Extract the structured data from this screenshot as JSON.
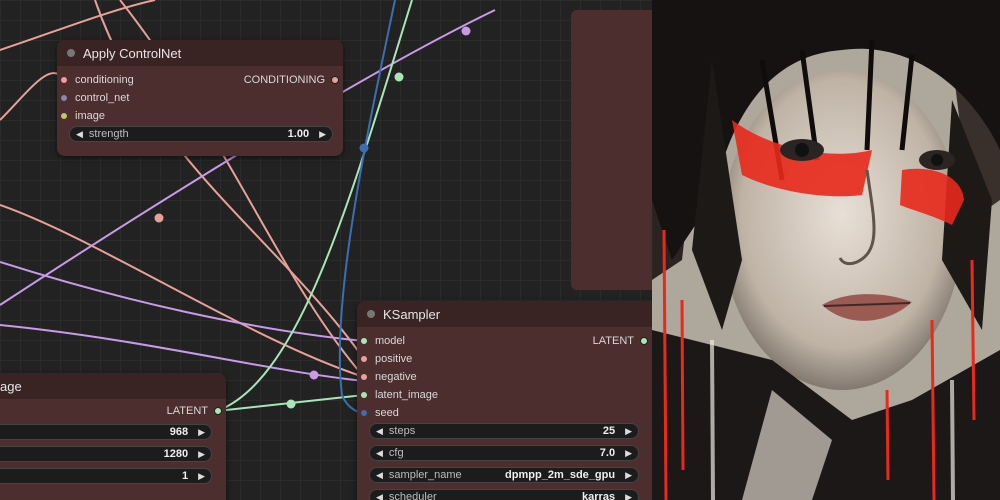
{
  "nodes": {
    "apply_controlnet": {
      "title": "Apply ControlNet",
      "inputs": [
        "conditioning",
        "control_net",
        "image"
      ],
      "output": "CONDITIONING",
      "widgets": [
        {
          "label": "strength",
          "value": "1.00"
        }
      ]
    },
    "ksampler": {
      "title": "KSampler",
      "inputs": [
        "model",
        "positive",
        "negative",
        "latent_image",
        "seed"
      ],
      "output": "LATENT",
      "widgets": [
        {
          "label": "steps",
          "value": "25"
        },
        {
          "label": "cfg",
          "value": "7.0"
        },
        {
          "label": "sampler_name",
          "value": "dpmpp_2m_sde_gpu"
        },
        {
          "label": "scheduler",
          "value": "karras"
        }
      ]
    },
    "empty_latent": {
      "title": "age",
      "output": "LATENT",
      "widgets": [
        {
          "label": "",
          "value": "968"
        },
        {
          "label": "",
          "value": "1280"
        },
        {
          "label": "",
          "value": "1"
        }
      ]
    }
  },
  "colors": {
    "node_body": "#4d2e2e",
    "node_header": "#3a2323",
    "wire_conditioning": "#e8a09a",
    "wire_latent": "#a8e6b8",
    "wire_model": "#c89ae8",
    "wire_seed": "#3a6fb0",
    "slot_image": "#b8c86a",
    "slot_control_net": "#8888aa"
  },
  "preview": {
    "subject": "painted portrait",
    "accent": "#e8291c"
  }
}
